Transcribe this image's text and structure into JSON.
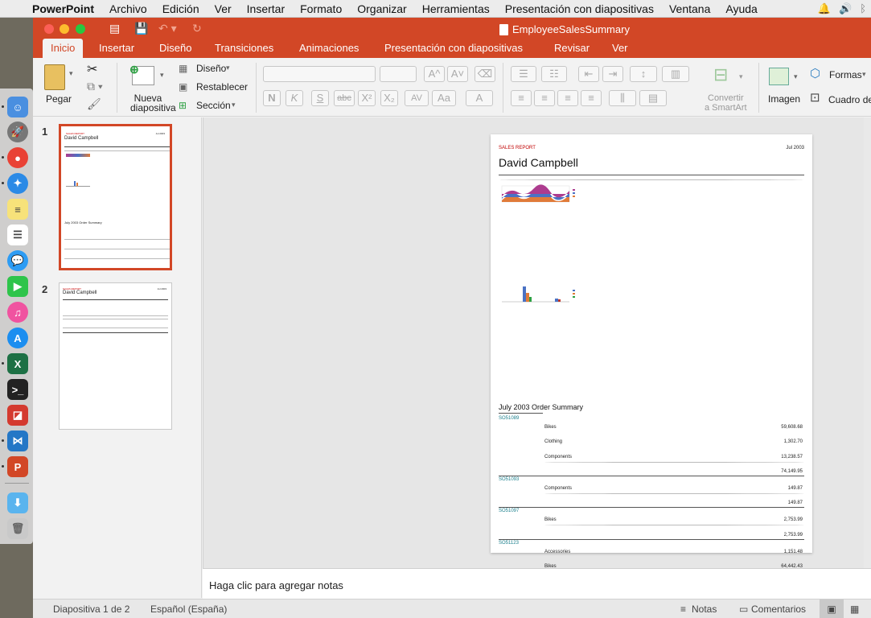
{
  "menubar": {
    "app": "PowerPoint",
    "items": [
      "Archivo",
      "Edición",
      "Ver",
      "Insertar",
      "Formato",
      "Organizar",
      "Herramientas",
      "Presentación con diapositivas",
      "Ventana",
      "Ayuda"
    ]
  },
  "window": {
    "title": "EmployeeSalesSummary",
    "tabs": [
      "Inicio",
      "Insertar",
      "Diseño",
      "Transiciones",
      "Animaciones",
      "Presentación con diapositivas",
      "Revisar",
      "Ver"
    ],
    "active_tab": "Inicio"
  },
  "ribbon": {
    "paste": "Pegar",
    "new_slide": "Nueva diapositiva",
    "layout": "Diseño",
    "reset": "Restablecer",
    "section": "Sección",
    "convert_smartart_1": "Convertir",
    "convert_smartart_2": "a SmartArt",
    "image": "Imagen",
    "shapes": "Formas",
    "textbox": "Cuadro de"
  },
  "thumbnails": {
    "slide1_num": "1",
    "slide2_num": "2"
  },
  "slide": {
    "report_label": "SALES REPORT",
    "date": "Jul 2003",
    "employee": "David Campbell",
    "summary_title": "July 2003 Order Summary",
    "orders": [
      {
        "id": "SO51089",
        "lines": [
          {
            "category": "Bikes",
            "amount": "59,608.68"
          },
          {
            "category": "Clothing",
            "amount": "1,302.70"
          },
          {
            "category": "Components",
            "amount": "13,238.57"
          }
        ],
        "total": "74,149.95"
      },
      {
        "id": "SO51093",
        "lines": [
          {
            "category": "Components",
            "amount": "149.87"
          }
        ],
        "total": "149.87"
      },
      {
        "id": "SO51097",
        "lines": [
          {
            "category": "Bikes",
            "amount": "2,753.99"
          }
        ],
        "total": "2,753.99"
      },
      {
        "id": "SO51123",
        "lines": [
          {
            "category": "Accessories",
            "amount": "1,151.48"
          },
          {
            "category": "Bikes",
            "amount": "64,442.43"
          }
        ]
      }
    ]
  },
  "notes": {
    "placeholder": "Haga clic para agregar notas"
  },
  "statusbar": {
    "slide_of": "Diapositiva 1 de 2",
    "language": "Español (España)",
    "notes": "Notas",
    "comments": "Comentarios"
  },
  "colors": {
    "accent": "#d24726",
    "order_id": "#1a7f8c",
    "report_label": "#c00000"
  }
}
